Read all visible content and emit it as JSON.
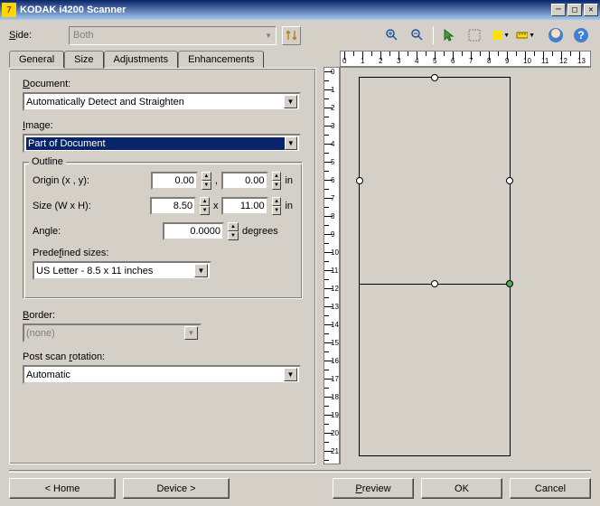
{
  "window": {
    "title": "KODAK i4200 Scanner"
  },
  "side": {
    "label": "Side:",
    "value": "Both"
  },
  "tabs": {
    "general": "General",
    "size": "Size",
    "adjustments": "Adjustments",
    "enhancements": "Enhancements"
  },
  "document": {
    "label": "Document:",
    "value": "Automatically Detect and Straighten"
  },
  "image": {
    "label": "Image:",
    "value": "Part of Document"
  },
  "outline": {
    "legend": "Outline",
    "origin_label": "Origin (x , y):",
    "origin_x": "0.00",
    "origin_y": "0.00",
    "origin_unit": "in",
    "comma": ",",
    "size_label": "Size (W x H):",
    "size_w": "8.50",
    "size_h": "11.00",
    "size_unit": "in",
    "x": "x",
    "angle_label": "Angle:",
    "angle": "0.0000",
    "angle_unit": "degrees",
    "predef_label": "Predefined sizes:",
    "predef_value": "US Letter - 8.5 x 11 inches"
  },
  "border": {
    "label": "Border:",
    "value": "(none)"
  },
  "rotation": {
    "label": "Post scan rotation:",
    "value": "Automatic"
  },
  "buttons": {
    "home": "< Home",
    "device": "Device >",
    "preview": "Preview",
    "ok": "OK",
    "cancel": "Cancel"
  }
}
